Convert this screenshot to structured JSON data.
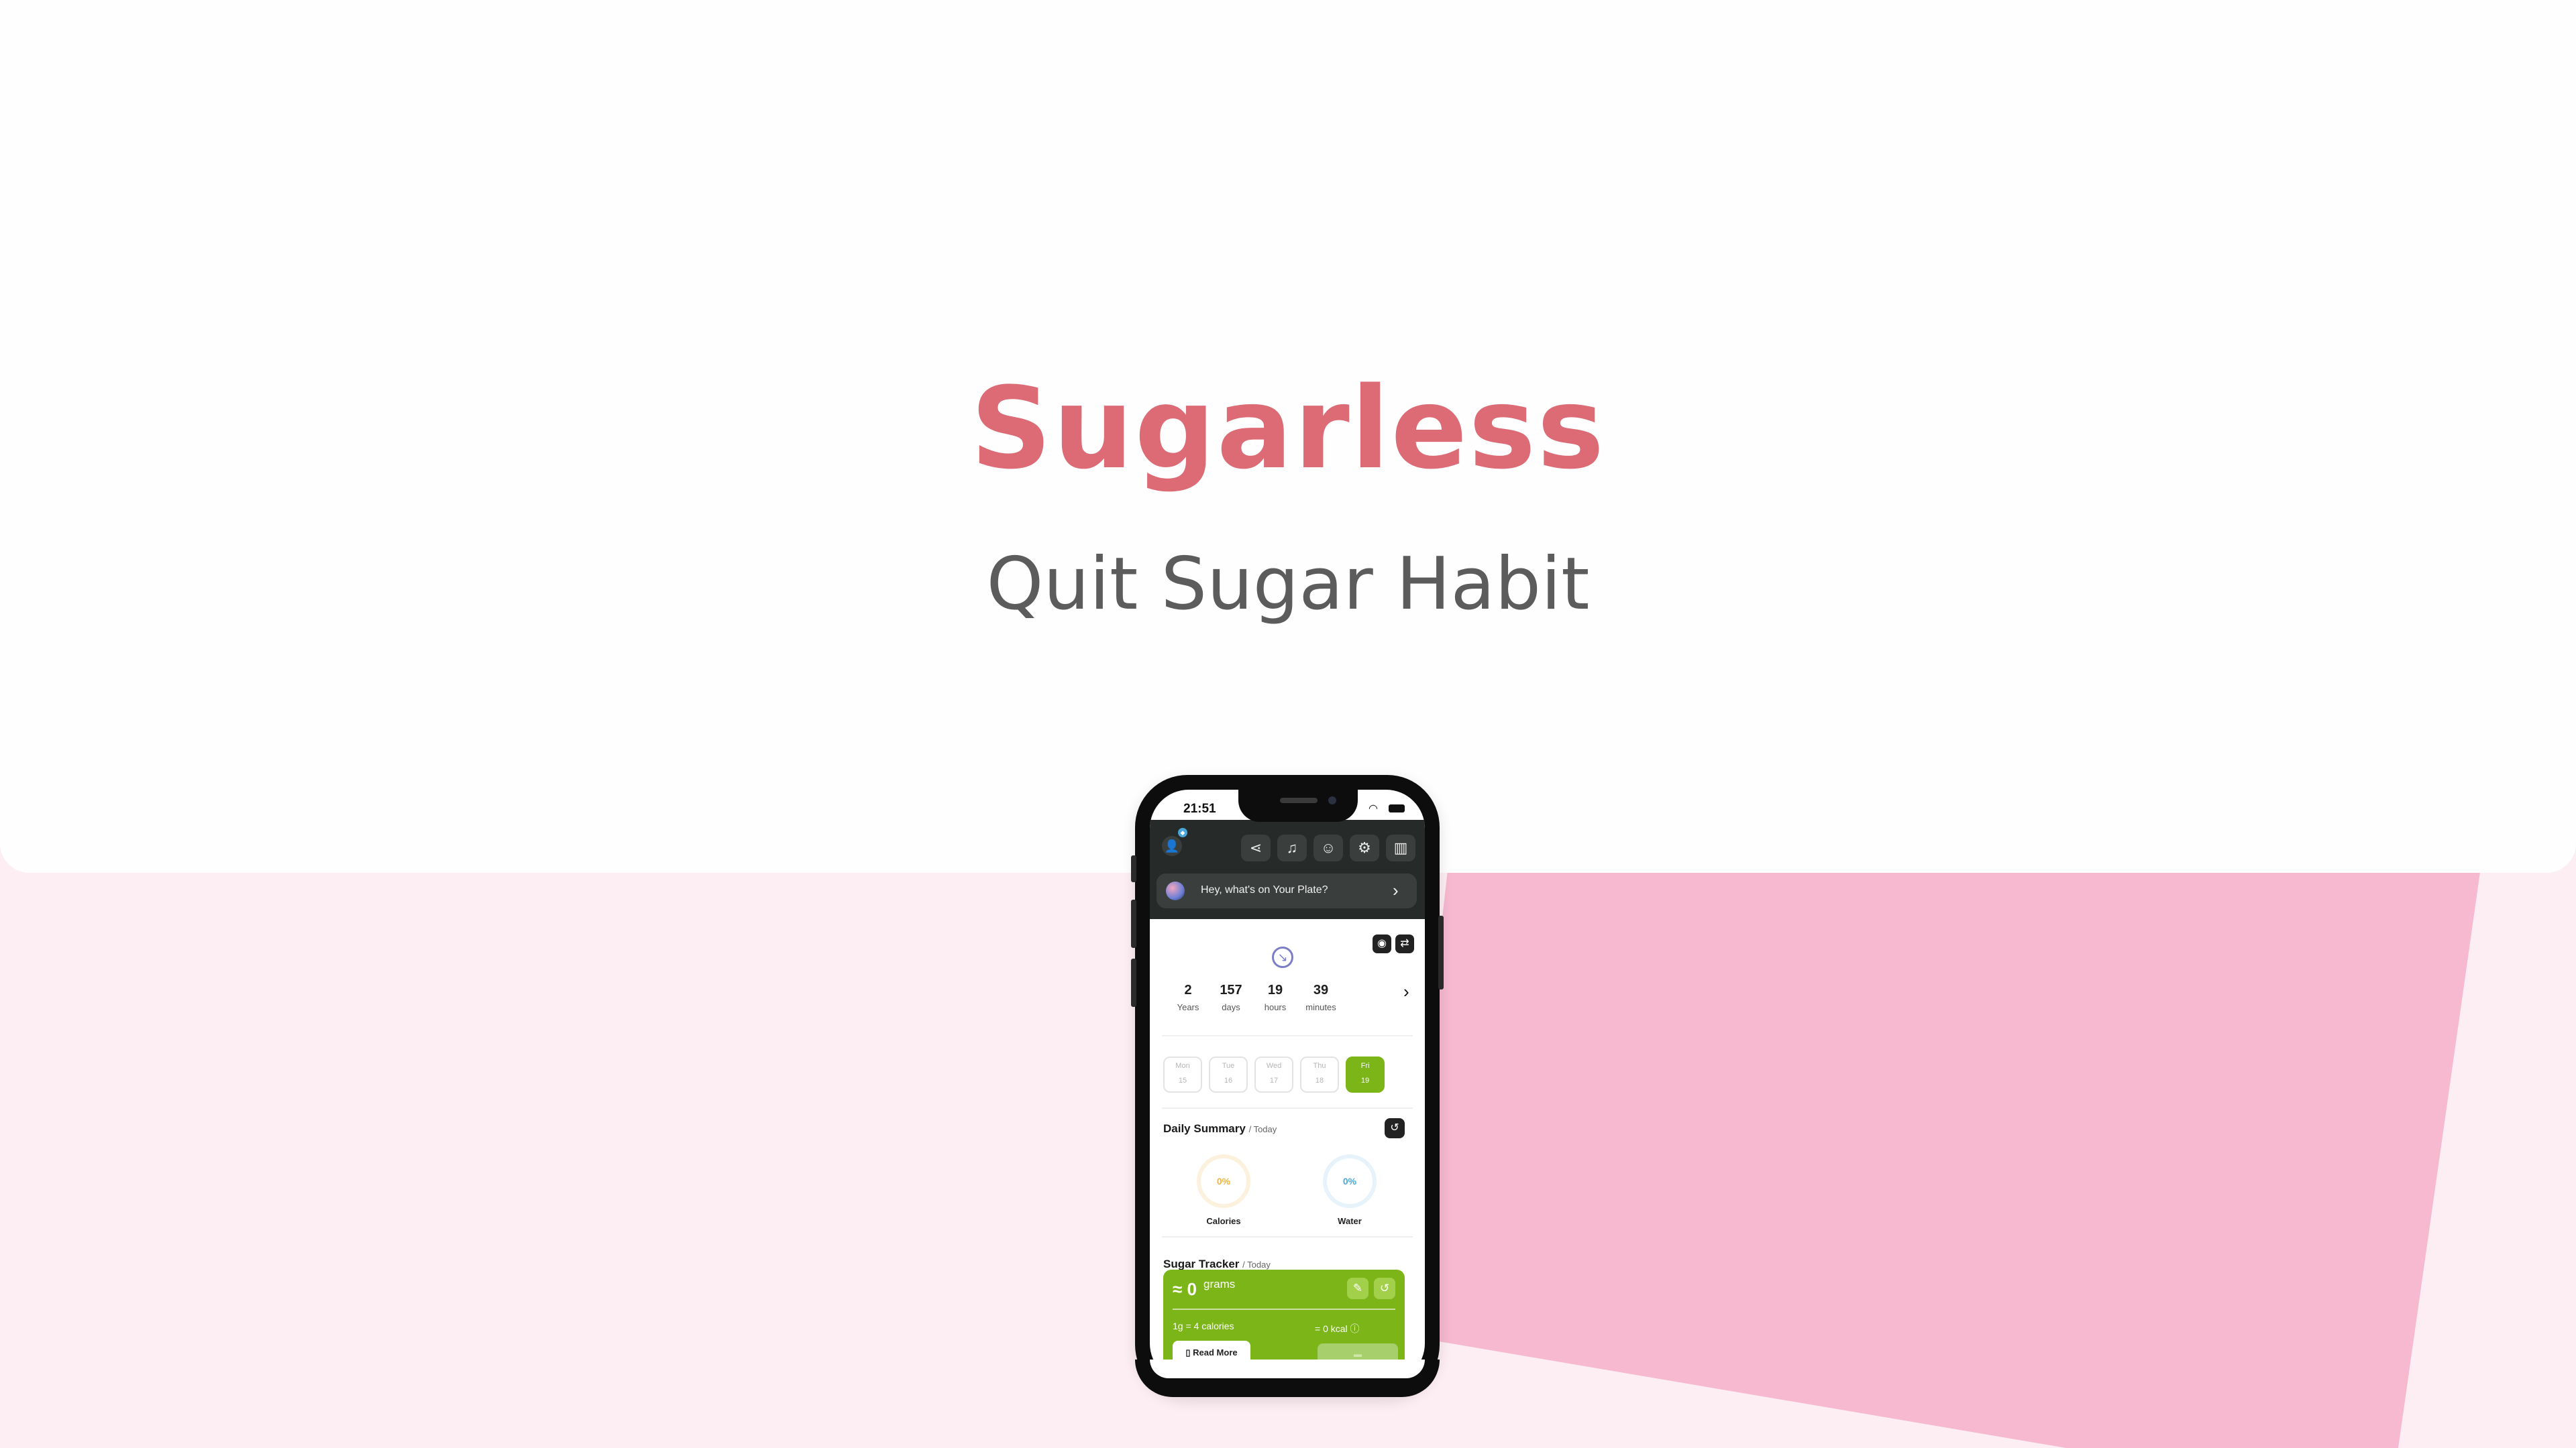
{
  "hero": {
    "title": "Sugarless",
    "subtitle": "Quit Sugar Habit"
  },
  "colors": {
    "brand": "#dc6b76",
    "pink_bg": "#fdeef3",
    "pink_shape": "#f6b9d0",
    "accent_green": "#7cb518",
    "header_dark": "#262a29"
  },
  "phone": {
    "status": {
      "time": "21:51"
    },
    "header": {
      "icons": [
        "share-icon",
        "bell-icon",
        "user-icon",
        "gear-icon",
        "bar-chart-icon"
      ],
      "prompt": "Hey, what's on Your Plate?"
    },
    "timer": {
      "stats": [
        {
          "value": "2",
          "label": "Years"
        },
        {
          "value": "157",
          "label": "days"
        },
        {
          "value": "19",
          "label": "hours"
        },
        {
          "value": "39",
          "label": "minutes"
        }
      ]
    },
    "days": [
      {
        "name": "Mon",
        "date": "15"
      },
      {
        "name": "Tue",
        "date": "16"
      },
      {
        "name": "Wed",
        "date": "17"
      },
      {
        "name": "Thu",
        "date": "18"
      },
      {
        "name": "Fri",
        "date": "19",
        "active": true
      }
    ],
    "daily_summary": {
      "title": "Daily Summary",
      "subtitle": "/ Today",
      "calories": {
        "value": "0%",
        "label": "Calories"
      },
      "water": {
        "value": "0%",
        "label": "Water"
      }
    },
    "sugar_tracker": {
      "title": "Sugar Tracker",
      "subtitle": "/ Today",
      "amount": "≈ 0",
      "unit": "grams",
      "conversion": "1g = 4 calories",
      "kcal": "= 0 kcal ⓘ",
      "read_more": "Read More"
    }
  }
}
